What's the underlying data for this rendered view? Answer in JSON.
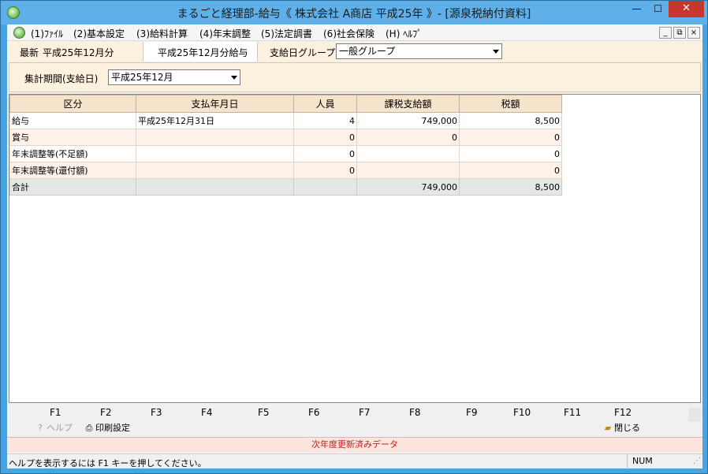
{
  "window": {
    "title": "まるごと経理部-給与《 株式会社  A商店  平成25年 》- [源泉税納付資料]",
    "min_glyph": "—",
    "max_glyph": "☐",
    "close_glyph": "✕"
  },
  "menu": {
    "items": [
      "(1)ﾌｧｲﾙ",
      "(2)基本設定",
      "(3)給料計算",
      "(4)年末調整",
      "(5)法定調書",
      "(6)社会保険",
      "(H) ﾍﾙﾌﾟ"
    ],
    "mdi_min": "_",
    "mdi_restore": "⧉",
    "mdi_close": "×"
  },
  "info": {
    "latest_label": "最新",
    "latest_value": "平成25年12月分",
    "current_tab": "平成25年12月分給与",
    "group_label": "支給日グループ",
    "group_value": "一般グループ"
  },
  "period": {
    "label": "集計期間(支給日)",
    "value": "平成25年12月"
  },
  "grid": {
    "headers": [
      "区分",
      "支払年月日",
      "人員",
      "課税支給額",
      "税額"
    ],
    "rows": [
      {
        "kubun": "給与",
        "date": "平成25年12月31日",
        "count": "4",
        "taxable": "749,000",
        "tax": "8,500"
      },
      {
        "kubun": "賞与",
        "date": "",
        "count": "0",
        "taxable": "0",
        "tax": "0"
      },
      {
        "kubun": "年末調整等(不足額)",
        "date": "",
        "count": "0",
        "taxable": "",
        "tax": "0"
      },
      {
        "kubun": "年末調整等(還付額)",
        "date": "",
        "count": "0",
        "taxable": "",
        "tax": "0"
      }
    ],
    "total": {
      "kubun": "合計",
      "date": "",
      "count": "",
      "taxable": "749,000",
      "tax": "8,500"
    }
  },
  "fkeys": {
    "labels": [
      "F1",
      "F2",
      "F3",
      "F4",
      "F5",
      "F6",
      "F7",
      "F8",
      "F9",
      "F10",
      "F11",
      "F12"
    ],
    "help": "ヘルプ",
    "print": "印刷設定",
    "close": "閉じる"
  },
  "notice": "次年度更新済みデータ",
  "status": {
    "text": "ヘルプを表示するには F1 キーを押してください。",
    "num": "NUM"
  }
}
